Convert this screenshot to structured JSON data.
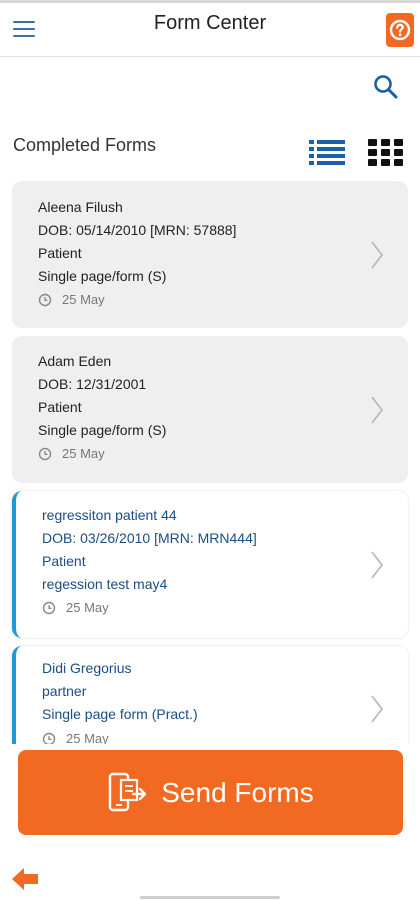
{
  "header": {
    "title": "Form Center"
  },
  "section": {
    "title": "Completed Forms"
  },
  "forms": [
    {
      "name": "Aleena Filush",
      "dob_line": "DOB:  05/14/2010  [MRN:  57888]",
      "role": "Patient",
      "form": "Single page/form (S)",
      "date": "25 May",
      "status": "pending"
    },
    {
      "name": "Adam Eden",
      "dob_line": "DOB:  12/31/2001",
      "role": "Patient",
      "form": "Single page/form (S)",
      "date": "25 May",
      "status": "pending"
    },
    {
      "name": "regressiton patient 44",
      "dob_line": "DOB:  03/26/2010  [MRN:  MRN444]",
      "role": "Patient",
      "form": "regession test may4",
      "date": "25 May",
      "status": "completed"
    },
    {
      "name": "Didi Gregorius",
      "role": "partner",
      "form": "Single page form (Pract.)",
      "date": "25 May",
      "status": "completed"
    }
  ],
  "actions": {
    "send_label": "Send Forms"
  },
  "colors": {
    "accent": "#f26a21",
    "blue": "#1a4d85",
    "completed_bar": "#1e9ad6",
    "card_bg": "#efefef"
  },
  "icons": [
    "menu-icon",
    "help-icon",
    "search-icon",
    "list-view-icon",
    "grid-view-icon",
    "clock-icon",
    "chevron-right-icon",
    "send-forms-icon",
    "back-arrow-icon"
  ]
}
